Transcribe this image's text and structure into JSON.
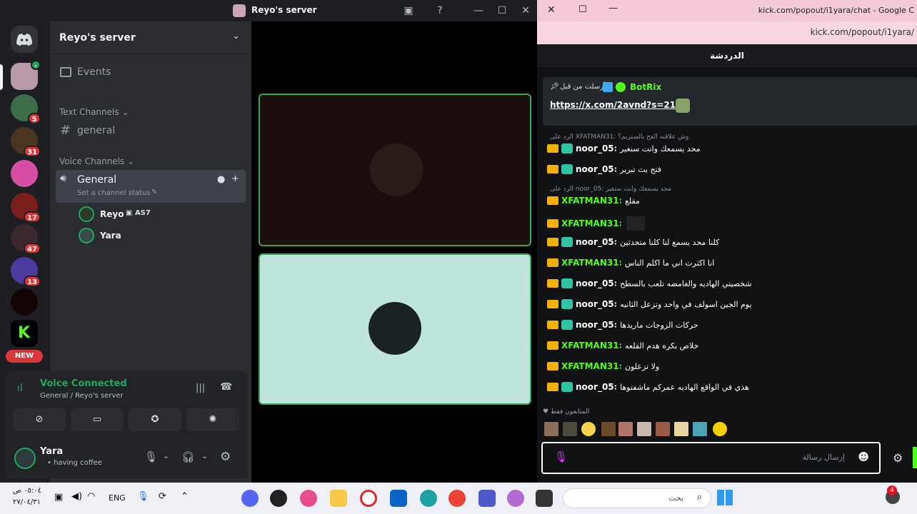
{
  "discord": {
    "window_title": "Reyo's server",
    "server_name": "Reyo's server",
    "events_label": "Events",
    "text_category": "Text Channels",
    "text_channel": "general",
    "voice_category": "Voice Channels",
    "voice_channel": "General",
    "channel_status_placeholder": "Set a channel status",
    "voice_users": [
      {
        "name": "Reyo",
        "tag": "AS7"
      },
      {
        "name": "Yara",
        "tag": ""
      }
    ],
    "guild_badges": [
      "5",
      "31",
      "17",
      "47",
      "13"
    ],
    "new_label": "NEW",
    "voice_connected": "Voice Connected",
    "voice_location": "General / Reyo's server",
    "user": {
      "name": "Yara",
      "status": "• having coffee"
    },
    "colors": {
      "accent": "#23a55a",
      "bg": "#2b2d31",
      "danger": "#da373c"
    }
  },
  "chrome": {
    "title_url": "kick.com/popout/i1yara/chat - Google C",
    "address": "kick.com/popout/i1yara/"
  },
  "kick": {
    "header": "الدردشة",
    "pinned": {
      "label": "أرسلت من قبل",
      "bot_name": "BotRix",
      "link": "https://x.com/2avnd?s=21"
    },
    "messages": [
      {
        "reply": "الرد على XFATMAN31: وش علاقته الفح بالستريم؟",
        "user": "noor_05",
        "text": "محد يسمعك وانت سنغير",
        "color": "#ffffff",
        "badge2": true
      },
      {
        "reply": "",
        "user": "noor_05",
        "text": "فتح بث تبرير",
        "color": "#ffffff",
        "badge2": true
      },
      {
        "reply": "الرد على noor_05: محد يسمعك وانت سنغير",
        "user": "XFATMAN31",
        "text": "مقلع",
        "color": "#53fc18",
        "badge2": false
      },
      {
        "reply": "",
        "user": "XFATMAN31",
        "text": "",
        "color": "#53fc18",
        "badge2": false
      },
      {
        "reply": "",
        "user": "noor_05",
        "text": "كلنا محد يسمع لنا كلنا متحدثين",
        "color": "#ffffff",
        "badge2": true
      },
      {
        "reply": "",
        "user": "XFATMAN31",
        "text": "انا اكثرت اني ما اكلم الناس",
        "color": "#53fc18",
        "badge2": false
      },
      {
        "reply": "",
        "user": "noor_05",
        "text": "شخصيتي الهاديه والغامضه تلعب بالسطح",
        "color": "#ffffff",
        "badge2": true
      },
      {
        "reply": "",
        "user": "noor_05",
        "text": "يوم الجين اسولف في واحد وتزعل الثانيه",
        "color": "#ffffff",
        "badge2": true
      },
      {
        "reply": "",
        "user": "noor_05",
        "text": "حركات الزوجات ماريدها",
        "color": "#ffffff",
        "badge2": true
      },
      {
        "reply": "",
        "user": "XFATMAN31",
        "text": "خلاص بكره هدم القلعه",
        "color": "#53fc18",
        "badge2": false
      },
      {
        "reply": "",
        "user": "XFATMAN31",
        "text": "ولا تزعلون",
        "color": "#53fc18",
        "badge2": false
      },
      {
        "reply": "",
        "user": "noor_05",
        "text": "هذي في الواقع الهاديه عمركم ماشفتوها",
        "color": "#ffffff",
        "badge2": true
      }
    ],
    "followers_only": "المتابعون فقط",
    "input_placeholder": "إرسال رسالة",
    "accent": "#53fc18"
  },
  "taskbar": {
    "time": "٠٥:٠٤ ص",
    "date": "٢٧/٠٤/٣١",
    "lang": "ENG",
    "search_placeholder": "بحث",
    "notif_count": "4"
  }
}
